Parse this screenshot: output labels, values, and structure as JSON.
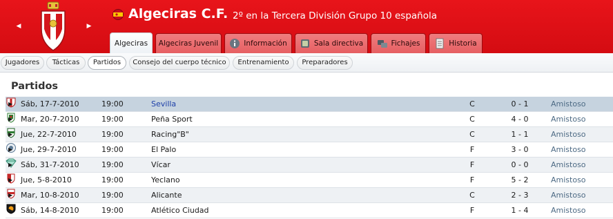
{
  "header": {
    "club_name": "Algeciras C.F.",
    "subtitle": "2º en la Tercera División Grupo 10 española",
    "colors": {
      "header_red": "#e1111a",
      "tab_red": "#e86b6d"
    }
  },
  "tabs": [
    {
      "label": "Algeciras",
      "icon": ""
    },
    {
      "label": "Algeciras Juvenil",
      "icon": ""
    },
    {
      "label": "Información",
      "icon": "info-icon"
    },
    {
      "label": "Sala directiva",
      "icon": "boardroom-icon"
    },
    {
      "label": "Fichajes",
      "icon": "transfers-icon"
    },
    {
      "label": "Historia",
      "icon": "history-icon"
    }
  ],
  "subnav": [
    "Jugadores",
    "Tácticas",
    "Partidos",
    "Consejo del cuerpo técnico",
    "Entrenamiento",
    "Preparadores"
  ],
  "section_title": "Partidos",
  "matches": [
    {
      "date": "Sáb, 17-7-2010",
      "time": "19:00",
      "team": "Sevilla",
      "venue": "C",
      "score": "0 - 1",
      "competition": "Amistoso"
    },
    {
      "date": "Mar, 20-7-2010",
      "time": "19:00",
      "team": "Peña Sport",
      "venue": "C",
      "score": "4 - 0",
      "competition": "Amistoso"
    },
    {
      "date": "Jue, 22-7-2010",
      "time": "19:00",
      "team": "Racing\"B\"",
      "venue": "C",
      "score": "1 - 1",
      "competition": "Amistoso"
    },
    {
      "date": "Jue, 29-7-2010",
      "time": "19:00",
      "team": "El Palo",
      "venue": "F",
      "score": "3 - 0",
      "competition": "Amistoso"
    },
    {
      "date": "Sáb, 31-7-2010",
      "time": "19:00",
      "team": "Vícar",
      "venue": "F",
      "score": "0 - 0",
      "competition": "Amistoso"
    },
    {
      "date": "Jue, 5-8-2010",
      "time": "19:00",
      "team": "Yeclano",
      "venue": "F",
      "score": "5 - 2",
      "competition": "Amistoso"
    },
    {
      "date": "Mar, 10-8-2010",
      "time": "19:00",
      "team": "Alicante",
      "venue": "C",
      "score": "2 - 3",
      "competition": "Amistoso"
    },
    {
      "date": "Sáb, 14-8-2010",
      "time": "19:00",
      "team": "Atlético Ciudad",
      "venue": "F",
      "score": "1 - 4",
      "competition": "Amistoso"
    }
  ]
}
